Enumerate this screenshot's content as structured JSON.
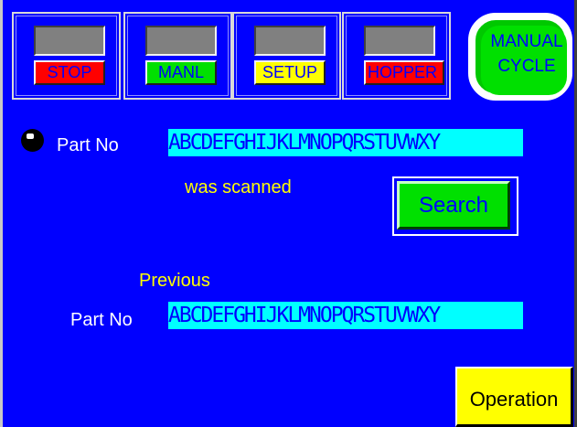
{
  "mode_buttons": {
    "stop": "STOP",
    "manl": "MANL",
    "setup": "SETUP",
    "hopper": "HOPPER"
  },
  "manual_cycle": {
    "line1": "MANUAL",
    "line2": "CYCLE"
  },
  "current_scan": {
    "label": "Part No",
    "value": "ABCDEFGHIJKLMNOPQRSTUVWXY",
    "status": "was scanned"
  },
  "search_label": "Search",
  "previous": {
    "heading": "Previous",
    "label": "Part No",
    "value": "ABCDEFGHIJKLMNOPQRSTUVWXY"
  },
  "operation_label": "Operation",
  "colors": {
    "background": "#0000ff",
    "stop": "#ff0000",
    "manl": "#00e000",
    "setup": "#ffff00",
    "hopper": "#ff0000",
    "field": "#00ffff",
    "accent_text": "#ffff00"
  }
}
